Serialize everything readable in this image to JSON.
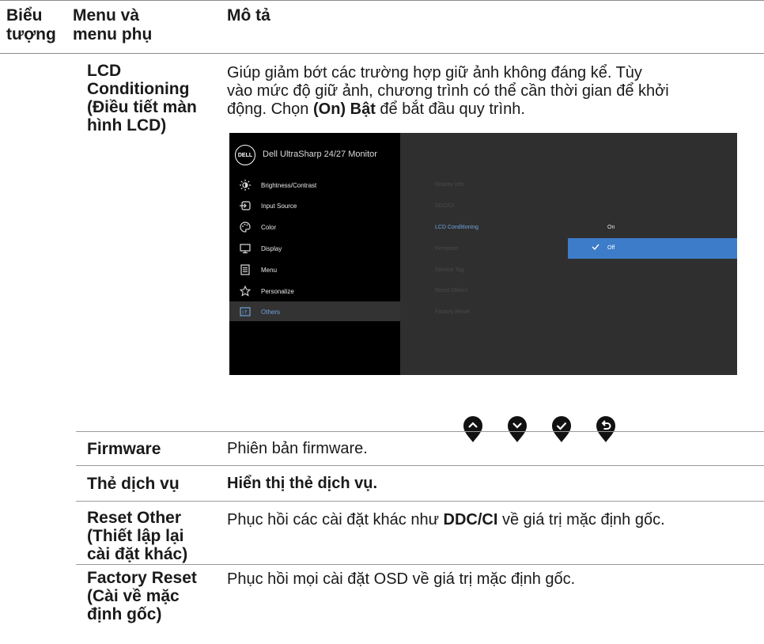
{
  "header": {
    "col_icon": "Biểu tượng",
    "col_icon_line1": "Biểu",
    "col_icon_line2": "tượng",
    "col_menu_line1": "Menu và",
    "col_menu_line2": "menu phụ",
    "col_desc": "Mô tả"
  },
  "rows": {
    "lcd": {
      "name": [
        "LCD",
        "Conditioning",
        "(Điều tiết màn",
        "hình LCD)"
      ],
      "desc_lines": [
        "Giúp giảm bớt các trường hợp giữ ảnh không đáng kể. Tùy",
        "vào mức độ giữ ảnh, chương trình có thể cần thời gian để khởi"
      ],
      "desc_last_prefix": "động. Chọn ",
      "desc_last_bold": "(On) Bật",
      "desc_last_suffix": " để bắt đầu quy trình."
    },
    "firmware": {
      "name": "Firmware",
      "desc": "Phiên bản firmware."
    },
    "service_tag": {
      "name": "Thẻ dịch vụ",
      "desc": "Hiển thị thẻ dịch vụ."
    },
    "reset_other": {
      "name": [
        "Reset Other",
        "(Thiết lập lại",
        "cài đặt khác)"
      ],
      "desc_prefix": "Phục hồi các cài đặt khác như ",
      "desc_bold": "DDC/CI",
      "desc_suffix": " về giá trị mặc định gốc."
    },
    "factory_reset": {
      "name": [
        "Factory Reset",
        "(Cài về mặc",
        "định gốc)"
      ],
      "desc": "Phục hồi mọi cài đặt OSD về giá trị mặc định gốc."
    }
  },
  "osd": {
    "logo": "DELL",
    "title": "Dell UltraSharp 24/27 Monitor",
    "menu": [
      {
        "label": "Brightness/Contrast",
        "icon": "brightness-icon"
      },
      {
        "label": "Input Source",
        "icon": "input-source-icon"
      },
      {
        "label": "Color",
        "icon": "color-palette-icon"
      },
      {
        "label": "Display",
        "icon": "display-icon"
      },
      {
        "label": "Menu",
        "icon": "menu-icon"
      },
      {
        "label": "Personalize",
        "icon": "star-icon"
      },
      {
        "label": "Others",
        "icon": "others-icon"
      }
    ],
    "selected_menu": "Others",
    "submenu": [
      "Display Info",
      "DDC/CI",
      "LCD Conditioning",
      "Firmware",
      "Service Tag",
      "Reset Others",
      "Factory Reset"
    ],
    "active_submenu": "LCD Conditioning",
    "options": {
      "on": "On",
      "off": "Off",
      "selected": "Off"
    },
    "colors": {
      "accent": "#3d7cc9",
      "highlight_text": "#6fa3dc"
    }
  },
  "nav_buttons": [
    "up-button",
    "down-button",
    "confirm-button",
    "back-button"
  ]
}
